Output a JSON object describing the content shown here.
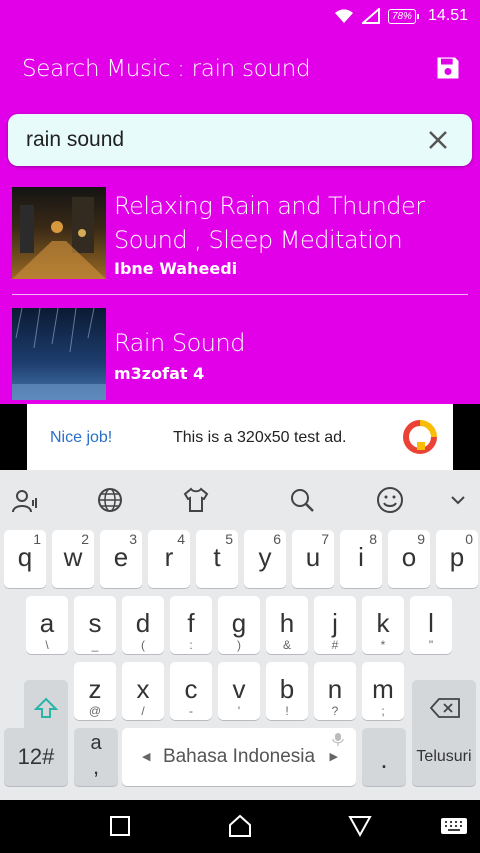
{
  "status_bar": {
    "battery": "78%",
    "time": "14.51"
  },
  "app_bar": {
    "title": "Search Music : rain sound"
  },
  "search": {
    "value": "rain sound",
    "placeholder": ""
  },
  "results": [
    {
      "title": "Relaxing Rain and Thunder Sound , Sleep Meditation",
      "artist": "Ibne Waheedi"
    },
    {
      "title": "Rain Sound",
      "artist": "m3zofat 4"
    }
  ],
  "ad": {
    "label": "Nice job!",
    "text": "This is a 320x50 test ad."
  },
  "keyboard": {
    "row1": [
      {
        "k": "q",
        "s": "1"
      },
      {
        "k": "w",
        "s": "2"
      },
      {
        "k": "e",
        "s": "3"
      },
      {
        "k": "r",
        "s": "4"
      },
      {
        "k": "t",
        "s": "5"
      },
      {
        "k": "y",
        "s": "6"
      },
      {
        "k": "u",
        "s": "7"
      },
      {
        "k": "i",
        "s": "8"
      },
      {
        "k": "o",
        "s": "9"
      },
      {
        "k": "p",
        "s": "0"
      }
    ],
    "row2": [
      {
        "k": "a",
        "s": "\\"
      },
      {
        "k": "s",
        "s": "_"
      },
      {
        "k": "d",
        "s": "("
      },
      {
        "k": "f",
        "s": ":"
      },
      {
        "k": "g",
        "s": ")"
      },
      {
        "k": "h",
        "s": "&"
      },
      {
        "k": "j",
        "s": "#"
      },
      {
        "k": "k",
        "s": "*"
      },
      {
        "k": "l",
        "s": "\""
      }
    ],
    "row3": [
      {
        "k": "z",
        "s": "@"
      },
      {
        "k": "x",
        "s": "/"
      },
      {
        "k": "c",
        "s": "-"
      },
      {
        "k": "v",
        "s": "'"
      },
      {
        "k": "b",
        "s": "!"
      },
      {
        "k": "n",
        "s": "?"
      },
      {
        "k": "m",
        "s": ";"
      }
    ],
    "symbols_key": "12#",
    "punct_key": {
      "main": "a",
      "sub": ","
    },
    "space_label": "Bahasa Indonesia",
    "period_key": ".",
    "action_key": "Telusuri"
  }
}
